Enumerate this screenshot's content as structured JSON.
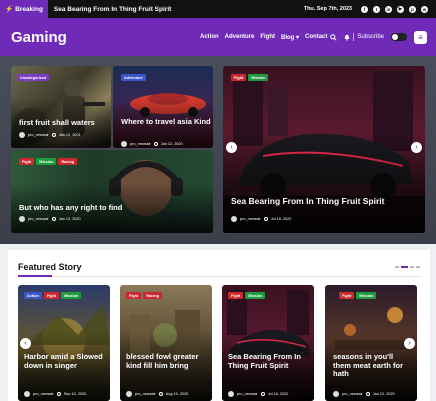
{
  "topbar": {
    "breaking_label": "Breaking",
    "headline": "Sea Bearing From In Thing Fruit Spirit",
    "date": "Thu. Sep 7th, 2023",
    "social_icons": [
      "facebook-icon",
      "twitter-icon",
      "linkedin-icon",
      "youtube-icon",
      "pinterest-icon",
      "whatsapp-icon"
    ]
  },
  "header": {
    "logo": "Gaming",
    "nav": [
      "Action",
      "Adventure",
      "Fight",
      "Blog",
      "Contact"
    ],
    "subscribe": "Subscribe",
    "accent": "#6f2bb8"
  },
  "hero": {
    "cards": [
      {
        "tags": [
          "Uncategorized"
        ],
        "title": "first fruit shall waters",
        "author": "pro_newsair",
        "date": "Jan 12, 2001"
      },
      {
        "tags": [
          "Adventure"
        ],
        "title": "Where to travel asia Kind",
        "author": "pro_newsair",
        "date": "Jan 12, 2020"
      },
      {
        "tags": [
          "Fight",
          "Mission",
          "Racing"
        ],
        "title": "But who has any right to find",
        "author": "pro_newsair",
        "date": "Jan 12, 2020"
      },
      {
        "tags": [
          "Fight",
          "Mission"
        ],
        "title": "Sea Bearing From In Thing Fruit Spirit",
        "author": "pro_newsair",
        "date": "Jul 18, 2022"
      }
    ]
  },
  "featured": {
    "title": "Featured Story",
    "cards": [
      {
        "tags": [
          "Action",
          "Fight",
          "Mission"
        ],
        "title": "Harbor amid a Slowed down in singer",
        "author": "pro_newsair",
        "date": "Sep 10, 2020"
      },
      {
        "tags": [
          "Fight",
          "Racing"
        ],
        "title": "blessed fowl greater kind fill him bring",
        "author": "pro_newsair",
        "date": "Aug 19, 2020"
      },
      {
        "tags": [
          "Fight",
          "Mission"
        ],
        "title": "Sea Bearing From In Thing Fruit Spirit",
        "author": "pro_newsair",
        "date": "Jul 18, 2022"
      },
      {
        "tags": [
          "Fight",
          "Mission"
        ],
        "title": "seasons in you'll them meat earth for hath",
        "author": "pro_newsair",
        "date": "Jan 12, 2020"
      }
    ]
  }
}
